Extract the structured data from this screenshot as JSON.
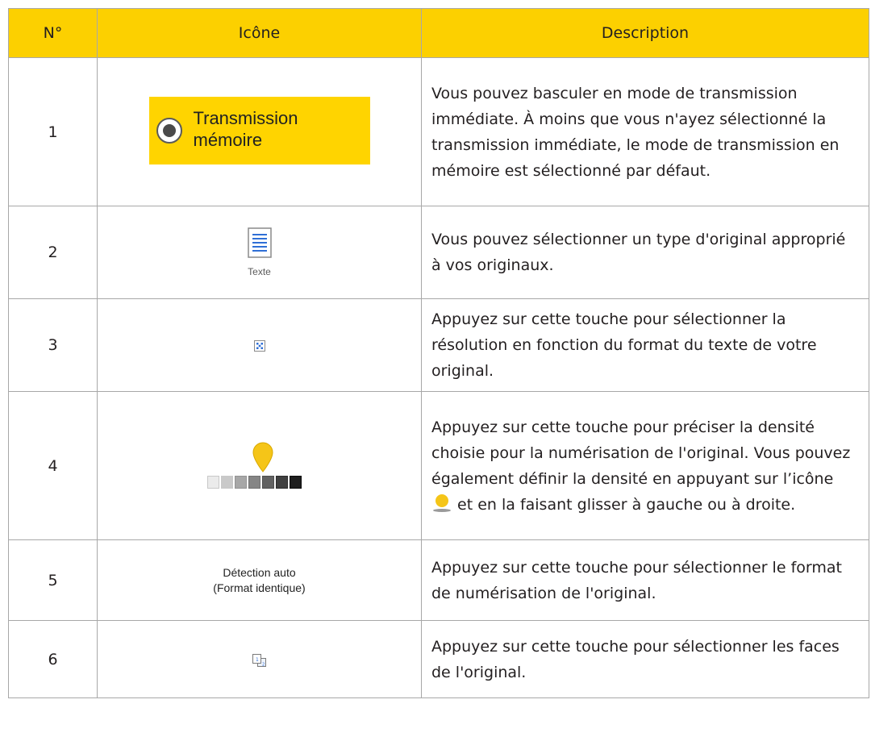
{
  "headers": {
    "num": "N°",
    "icon": "Icône",
    "description": "Description"
  },
  "rows": [
    {
      "num": "1",
      "icon_name": "transmission-memoire-button",
      "icon_label_line1": "Transmission",
      "icon_label_line2": "mémoire",
      "description": "Vous pouvez basculer en mode de transmission immédiate. À moins que vous n'ayez sélectionné la transmission immédiate, le mode de transmission en mémoire est sélectionné par défaut."
    },
    {
      "num": "2",
      "icon_name": "text-document-icon",
      "icon_caption": "Texte",
      "description": "Vous pouvez sélectionner un type d'original approprié à vos originaux."
    },
    {
      "num": "3",
      "icon_name": "resolution-icon",
      "description": "Appuyez sur cette touche pour sélectionner la résolution en fonction du format du texte de votre original."
    },
    {
      "num": "4",
      "icon_name": "density-slider-icon",
      "density_level": 4,
      "density_steps": 7,
      "description_part1": "Appuyez sur cette touche pour préciser la densité choisie pour la numérisation de l'original. Vous pouvez également définir la densité en appuyant sur l’icône ",
      "description_part2": " et en la faisant glisser à gauche ou à droite."
    },
    {
      "num": "5",
      "icon_name": "detection-auto-label",
      "icon_label_line1": "Détection auto",
      "icon_label_line2": "(Format identique)",
      "description": "Appuyez sur cette touche pour sélectionner le format de numérisation de l'original."
    },
    {
      "num": "6",
      "icon_name": "duplex-original-icon",
      "icon_digit_front": "1",
      "icon_digit_back": "2",
      "description": "Appuyez sur cette touche pour sélectionner les faces de l'original."
    }
  ],
  "colors": {
    "header_bg": "#fcd000",
    "button_bg": "#ffd400",
    "border": "#a8a8a8",
    "pin": "#f5c518",
    "doc_lines": "#2f6fd6"
  }
}
